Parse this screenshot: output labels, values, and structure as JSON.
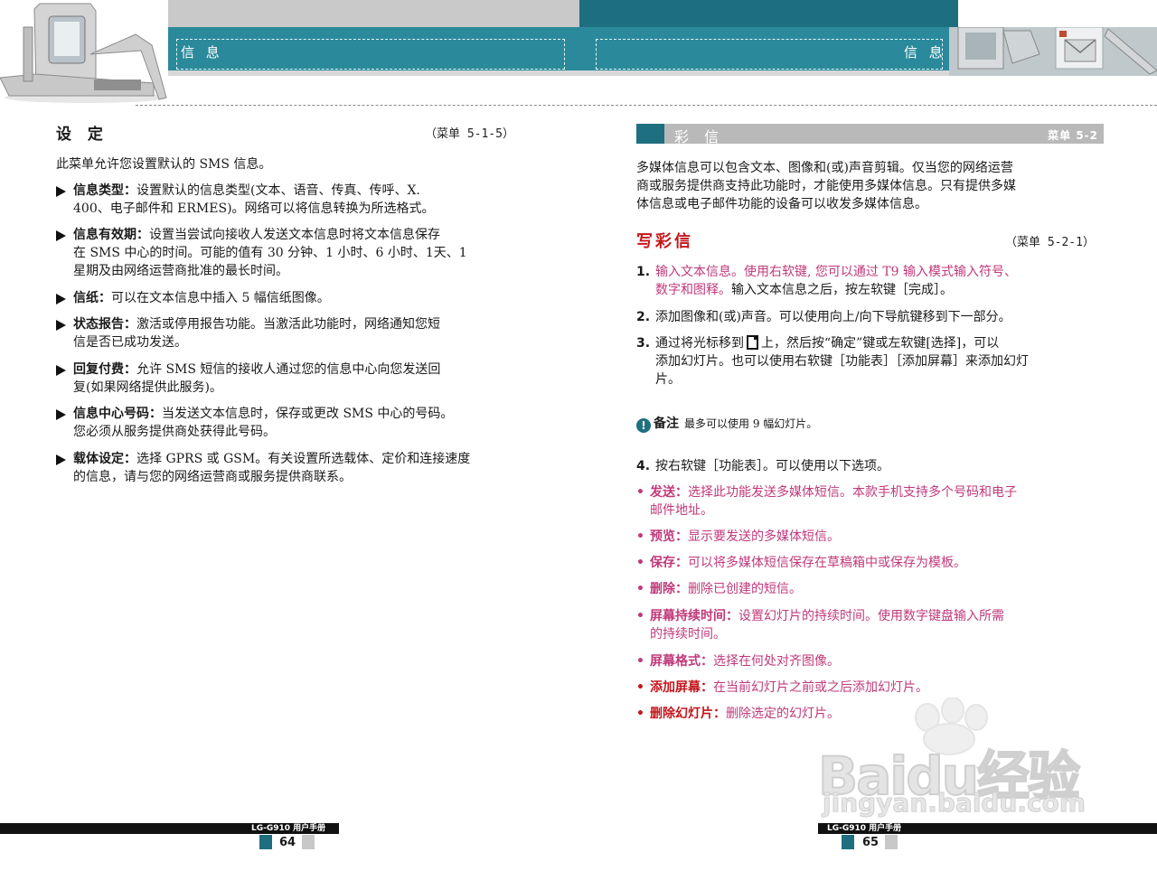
{
  "header": {
    "left_title": "信 息",
    "right_title": "信 息"
  },
  "left_page": {
    "section_title": "设 定",
    "menu_ref": "（菜单 5-1-5）",
    "intro": "此菜单允许您设置默认的 SMS 信息。",
    "items": [
      {
        "label": "信息类型：",
        "line1": "设置默认的信息类型(文本、语音、传真、传呼、X.",
        "line2": "400、电子邮件和 ERMES)。网络可以将信息转换为所选格式。",
        "line3": ""
      },
      {
        "label": "信息有效期：",
        "line1": "设置当尝试向接收人发送文本信息时将文本信息保存",
        "line2": "在 SMS 中心的时间。可能的值有 30 分钟、1 小时、6 小时、1天、1",
        "line3": "星期及由网络运营商批准的最长时间。"
      },
      {
        "label": "信纸：",
        "line1": "可以在文本信息中插入 5  幅信纸图像。",
        "line2": "",
        "line3": ""
      },
      {
        "label": "状态报告：",
        "line1": "激活或停用报告功能。当激活此功能时，网络通知您短",
        "line2": "信是否已成功发送。",
        "line3": ""
      },
      {
        "label": "回复付费：",
        "line1": "允许 SMS 短信的接收人通过您的信息中心向您发送回",
        "line2": "复(如果网络提供此服务)。",
        "line3": ""
      },
      {
        "label": "信息中心号码：",
        "line1": "当发送文本信息时，保存或更改 SMS 中心的号码。",
        "line2": "您必须从服务提供商处获得此号码。",
        "line3": ""
      },
      {
        "label": "载体设定：",
        "line1": "选择 GPRS 或 GSM。有关设置所选载体、定价和连接速度",
        "line2": "的信息，请与您的网络运营商或服务提供商联系。",
        "line3": ""
      }
    ],
    "footer_text": "LG-G910 用户手册",
    "page_number": "64"
  },
  "right_page": {
    "bar_title": "彩 信",
    "bar_menu": "菜单 5-2",
    "intro_lines": [
      "多媒体信息可以包含文本、图像和(或)声音剪辑。仅当您的网络运营",
      "商或服务提供商支持此功能时，才能使用多媒体信息。只有提供多媒",
      "体信息或电子邮件功能的设备可以收发多媒体信息。"
    ],
    "section_title": "写彩信",
    "menu_ref": "（菜单 5-2-1）",
    "steps": [
      {
        "num": "1.",
        "l1_pink": "输入文本信息。使用右软键, 您可以通过 T9 输入模式输入符号、",
        "l2_pink": "数字和图释。",
        "l2_rest": "输入文本信息之后，按左软键［完成］。"
      },
      {
        "num": "2.",
        "text": "添加图像和(或)声音。可以使用向上/向下导航键移到下一部分。"
      },
      {
        "num": "3.",
        "l1_a": "通过将光标移到",
        "l1_b": "上，然后按“确定”键或左软键[选择]，可以",
        "l2": "添加幻灯片。也可以使用右软键［功能表］［添加屏幕］来添加幻灯",
        "l3": "片。"
      },
      {
        "num": "4.",
        "text": "按右软键［功能表］。可以使用以下选项。"
      }
    ],
    "note_icon": "!",
    "note_label": "备注",
    "note_text": "最多可以使用 9  幅幻灯片。",
    "bullets": [
      {
        "label": "发送：",
        "line1": "选择此功能发送多媒体短信。本款手机支持多个号码和电子",
        "line2": "邮件地址。"
      },
      {
        "label": "预览：",
        "line1": "显示要发送的多媒体短信。",
        "line2": ""
      },
      {
        "label": "保存：",
        "line1": "可以将多媒体短信保存在草稿箱中或保存为模板。",
        "line2": ""
      },
      {
        "label": "删除：",
        "line1": "删除已创建的短信。",
        "line2": ""
      },
      {
        "label": "屏幕持续时间：",
        "line1": "设置幻灯片的持续时间。使用数字键盘输入所需",
        "line2": "的持续时间。"
      },
      {
        "label": "屏幕格式：",
        "line1": "选择在何处对齐图像。",
        "line2": ""
      },
      {
        "label": "添加屏幕：",
        "line1": "在当前幻灯片之前或之后添加幻灯片。",
        "line2": ""
      },
      {
        "label": "删除幻灯片：",
        "line1": "删除选定的幻灯片。",
        "line2": ""
      }
    ],
    "footer_text": "LG-G910 用户手册",
    "page_number": "65"
  },
  "watermark": {
    "main": "Baidu经验",
    "sub": "jingyan.baidu.com"
  },
  "colors": {
    "teal": "#2a8a9b",
    "dark_teal": "#1e6f80",
    "pink": "#c0397a",
    "red": "#c4161c"
  }
}
